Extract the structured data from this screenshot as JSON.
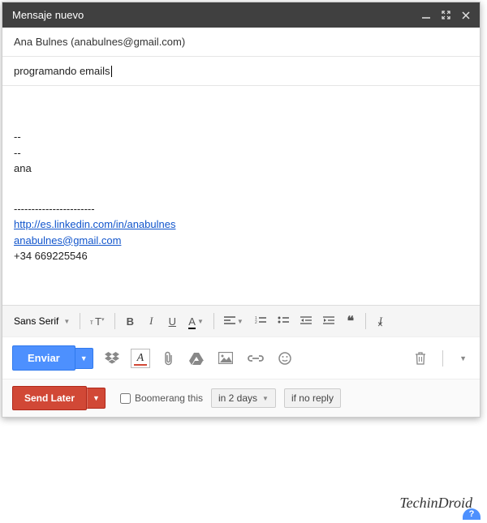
{
  "header": {
    "title": "Mensaje nuevo"
  },
  "to": {
    "display": "Ana Bulnes (anabulnes@gmail.com)"
  },
  "subject": {
    "value": "programando emails"
  },
  "body": {
    "line1": "--",
    "line2": "--",
    "name": "ana",
    "dashes": "-----------------------",
    "link1": "http://es.linkedin.com/in/anabulnes",
    "link2": "anabulnes@gmail.com",
    "phone": "+34 669225546"
  },
  "format": {
    "font": "Sans Serif"
  },
  "actions": {
    "send": "Enviar"
  },
  "boomerang": {
    "send_later": "Send Later",
    "label": "Boomerang this",
    "when": "in 2 days",
    "if_no_reply": "if no reply"
  },
  "watermark": "TechinDroid"
}
